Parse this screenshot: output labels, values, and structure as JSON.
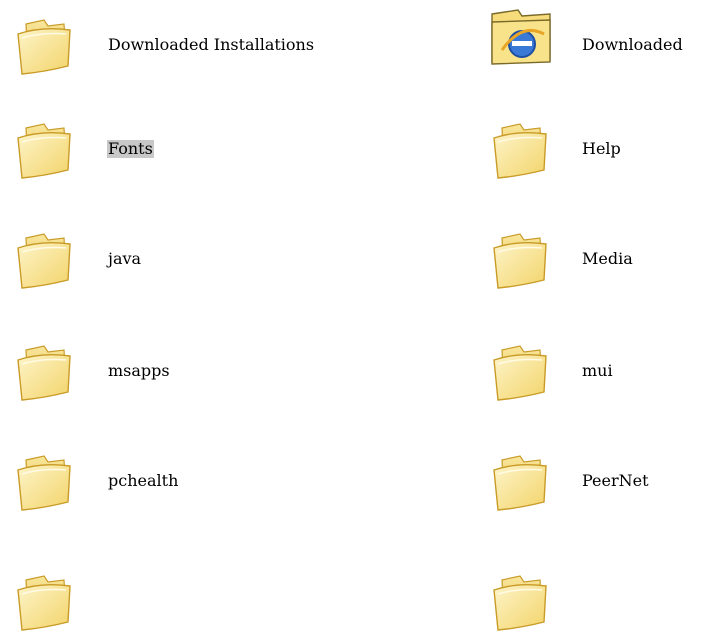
{
  "colors": {
    "folder_front": "#f9e8a3",
    "folder_back": "#f6dc7a",
    "folder_outline": "#c99b27",
    "selected_label_bg": "#c8c8c8"
  },
  "items": [
    {
      "label": "Downloaded Installations",
      "icon": "folder-icon"
    },
    {
      "label": "Downloaded",
      "icon": "internet-explorer-folder-icon"
    },
    {
      "label": "Fonts",
      "icon": "folder-icon",
      "selected": true
    },
    {
      "label": "Help",
      "icon": "folder-icon"
    },
    {
      "label": "java",
      "icon": "folder-icon"
    },
    {
      "label": "Media",
      "icon": "folder-icon"
    },
    {
      "label": "msapps",
      "icon": "folder-icon"
    },
    {
      "label": "mui",
      "icon": "folder-icon"
    },
    {
      "label": "pchealth",
      "icon": "folder-icon"
    },
    {
      "label": "PeerNet",
      "icon": "folder-icon"
    },
    {
      "label": "",
      "icon": "folder-icon"
    },
    {
      "label": "",
      "icon": "folder-icon"
    }
  ]
}
